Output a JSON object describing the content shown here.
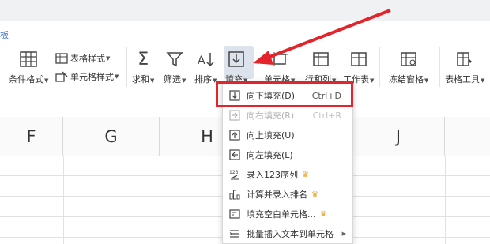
{
  "tab_partial": "板",
  "ribbon": {
    "conditional_format": "条件格式",
    "table_style": "表格样式",
    "cell_style": "单元格样式",
    "sum": "求和",
    "filter": "筛选",
    "sort": "排序",
    "fill": "填充",
    "cell": "单元格",
    "row_col": "行和列",
    "worksheet": "工作表",
    "freeze": "冻结窗格",
    "table_tools": "表格工具"
  },
  "columns": [
    "F",
    "G",
    "H",
    "J"
  ],
  "fill_menu": [
    {
      "label": "向下填充(D)",
      "shortcut": "Ctrl+D",
      "icon": "fill-down-icon",
      "disabled": false,
      "premium": false
    },
    {
      "label": "向右填充(R)",
      "shortcut": "Ctrl+R",
      "icon": "fill-right-icon",
      "disabled": true,
      "premium": false
    },
    {
      "label": "向上填充(U)",
      "shortcut": "",
      "icon": "fill-up-icon",
      "disabled": false,
      "premium": false
    },
    {
      "label": "向左填充(L)",
      "shortcut": "",
      "icon": "fill-left-icon",
      "disabled": false,
      "premium": false
    },
    {
      "label": "录入123序列",
      "shortcut": "",
      "icon": "sequence-icon",
      "disabled": false,
      "premium": true
    },
    {
      "label": "计算并录入排名",
      "shortcut": "",
      "icon": "ranking-icon",
      "disabled": false,
      "premium": true
    },
    {
      "label": "填充空白单元格...",
      "shortcut": "",
      "icon": "blank-cell-icon",
      "disabled": false,
      "premium": true
    },
    {
      "label": "批量插入文本到单元格",
      "shortcut": "",
      "icon": "insert-text-icon",
      "disabled": false,
      "premium": false
    }
  ],
  "colors": {
    "highlight": "#e3242b",
    "crown": "#f0a020",
    "tab_accent": "#3b6fd6"
  }
}
